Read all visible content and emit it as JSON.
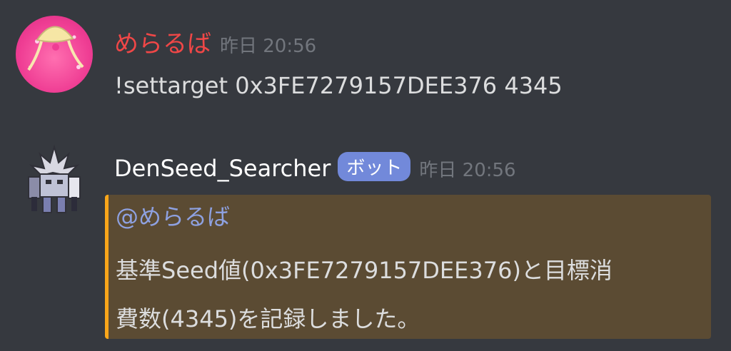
{
  "messages": [
    {
      "author": "めらるば",
      "timestamp": "昨日 20:56",
      "content": "!settarget 0x3FE7279157DEE376 4345",
      "name_color": "#f04747"
    },
    {
      "author": "DenSeed_Searcher",
      "badge": "ボット",
      "timestamp": "昨日 20:56",
      "embed": {
        "mention": "@めらるば",
        "description_line1": "基準Seed値(0x3FE7279157DEE376)と目標消",
        "description_line2": "費数(4345)を記録しました。",
        "accent_color": "#faa61a"
      }
    }
  ],
  "theme": {
    "background": "#36393f",
    "badge_color": "#7289da",
    "embed_background": "#5b4b33"
  }
}
